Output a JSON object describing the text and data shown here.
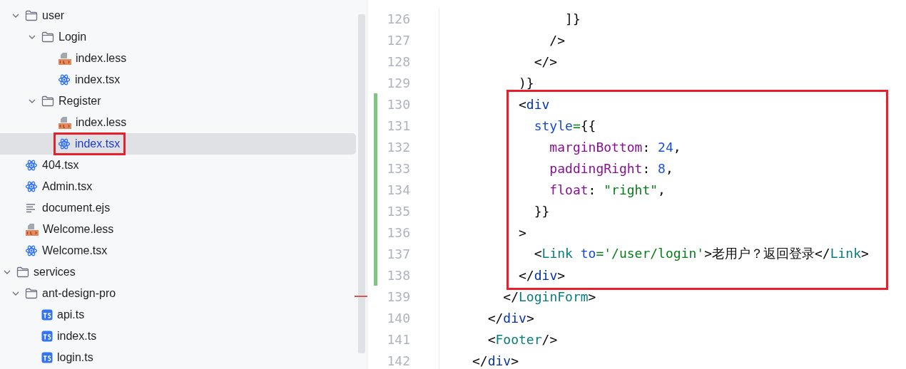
{
  "project_tree": {
    "items": [
      {
        "children": [
          {
            "label": "user",
            "kind": "folder",
            "expanded": true,
            "selected": false,
            "children": [
              {
                "label": "Login",
                "kind": "folder",
                "expanded": true,
                "selected": false,
                "children": [
                  {
                    "label": "index.less",
                    "kind": "less",
                    "selected": false
                  },
                  {
                    "label": "index.tsx",
                    "kind": "react",
                    "selected": false
                  }
                ]
              },
              {
                "label": "Register",
                "kind": "folder",
                "expanded": true,
                "selected": false,
                "children": [
                  {
                    "label": "index.less",
                    "kind": "less",
                    "selected": false
                  },
                  {
                    "label": "index.tsx",
                    "kind": "react",
                    "selected": true,
                    "boxed": true
                  }
                ]
              }
            ]
          },
          {
            "label": "404.tsx",
            "kind": "react",
            "selected": false
          },
          {
            "label": "Admin.tsx",
            "kind": "react",
            "selected": false
          },
          {
            "label": "document.ejs",
            "kind": "text",
            "selected": false
          },
          {
            "label": "Welcome.less",
            "kind": "less",
            "selected": false
          },
          {
            "label": "Welcome.tsx",
            "kind": "react",
            "selected": false
          }
        ]
      },
      {
        "label": "services",
        "kind": "folder",
        "expanded": true,
        "selected": false,
        "children": [
          {
            "label": "ant-design-pro",
            "kind": "folder",
            "expanded": true,
            "selected": false,
            "children": [
              {
                "label": "api.ts",
                "kind": "ts",
                "selected": false
              },
              {
                "label": "index.ts",
                "kind": "ts",
                "selected": false
              },
              {
                "label": "login.ts",
                "kind": "ts",
                "selected": false
              }
            ]
          }
        ]
      }
    ]
  },
  "editor": {
    "lines": [
      {
        "number": "126",
        "changed": false,
        "boxed": false,
        "tokens": [
          {
            "text": "            ]}",
            "kind": "plain"
          }
        ]
      },
      {
        "number": "127",
        "changed": false,
        "boxed": false,
        "tokens": [
          {
            "text": "          />",
            "kind": "plain"
          }
        ]
      },
      {
        "number": "128",
        "changed": false,
        "boxed": false,
        "tokens": [
          {
            "text": "        </>",
            "kind": "plain"
          }
        ]
      },
      {
        "number": "129",
        "changed": false,
        "boxed": false,
        "tokens": [
          {
            "text": "      )}",
            "kind": "plain"
          }
        ]
      },
      {
        "number": "130",
        "changed": true,
        "boxed": true,
        "tokens": [
          {
            "text": "      <",
            "kind": "plain"
          },
          {
            "text": "div",
            "kind": "tag"
          }
        ]
      },
      {
        "number": "131",
        "changed": true,
        "boxed": true,
        "tokens": [
          {
            "text": "        style",
            "kind": "attr"
          },
          {
            "text": "=",
            "kind": "str"
          },
          {
            "text": "{{",
            "kind": "plain"
          }
        ]
      },
      {
        "number": "132",
        "changed": true,
        "boxed": true,
        "tokens": [
          {
            "text": "          marginBottom",
            "kind": "prop"
          },
          {
            "text": ": ",
            "kind": "plain"
          },
          {
            "text": "24",
            "kind": "num"
          },
          {
            "text": ",",
            "kind": "plain"
          }
        ]
      },
      {
        "number": "133",
        "changed": true,
        "boxed": true,
        "tokens": [
          {
            "text": "          paddingRight",
            "kind": "prop"
          },
          {
            "text": ": ",
            "kind": "plain"
          },
          {
            "text": "8",
            "kind": "num"
          },
          {
            "text": ",",
            "kind": "plain"
          }
        ]
      },
      {
        "number": "134",
        "changed": true,
        "boxed": true,
        "tokens": [
          {
            "text": "          float",
            "kind": "prop"
          },
          {
            "text": ": ",
            "kind": "plain"
          },
          {
            "text": "\"right\"",
            "kind": "str"
          },
          {
            "text": ",",
            "kind": "plain"
          }
        ]
      },
      {
        "number": "135",
        "changed": true,
        "boxed": true,
        "tokens": [
          {
            "text": "        }}",
            "kind": "plain"
          }
        ]
      },
      {
        "number": "136",
        "changed": true,
        "boxed": true,
        "tokens": [
          {
            "text": "      >",
            "kind": "plain"
          }
        ]
      },
      {
        "number": "137",
        "changed": true,
        "boxed": true,
        "tokens": [
          {
            "text": "        <",
            "kind": "plain"
          },
          {
            "text": "Link",
            "kind": "component"
          },
          {
            "text": " to",
            "kind": "attr"
          },
          {
            "text": "=",
            "kind": "str"
          },
          {
            "text": "'/user/login'",
            "kind": "str"
          },
          {
            "text": ">老用户？返回登录</",
            "kind": "plain"
          },
          {
            "text": "Link",
            "kind": "component"
          },
          {
            "text": ">",
            "kind": "plain"
          }
        ]
      },
      {
        "number": "138",
        "changed": true,
        "boxed": true,
        "tokens": [
          {
            "text": "      </",
            "kind": "plain"
          },
          {
            "text": "div",
            "kind": "tag"
          },
          {
            "text": ">",
            "kind": "plain"
          }
        ]
      },
      {
        "number": "139",
        "changed": false,
        "boxed": false,
        "tokens": [
          {
            "text": "    </",
            "kind": "plain"
          },
          {
            "text": "LoginForm",
            "kind": "component"
          },
          {
            "text": ">",
            "kind": "plain"
          }
        ]
      },
      {
        "number": "140",
        "changed": false,
        "boxed": false,
        "tokens": [
          {
            "text": "  </",
            "kind": "plain"
          },
          {
            "text": "div",
            "kind": "tag"
          },
          {
            "text": ">",
            "kind": "plain"
          }
        ]
      },
      {
        "number": "141",
        "changed": false,
        "boxed": false,
        "tokens": [
          {
            "text": "  <",
            "kind": "plain"
          },
          {
            "text": "Footer",
            "kind": "component"
          },
          {
            "text": "/>",
            "kind": "plain"
          }
        ]
      },
      {
        "number": "142",
        "changed": false,
        "boxed": false,
        "tokens": [
          {
            "text": "</",
            "kind": "plain"
          },
          {
            "text": "div",
            "kind": "tag"
          },
          {
            "text": ">",
            "kind": "plain"
          }
        ]
      }
    ]
  }
}
